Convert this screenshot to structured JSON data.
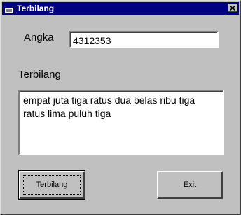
{
  "window": {
    "title": "Terbilang",
    "app_icon": "app-window-icon",
    "close_icon": "close-x-icon"
  },
  "form": {
    "angka_label": "Angka",
    "angka_value": "4312353",
    "terbilang_label": "Terbilang",
    "terbilang_text": "empat juta tiga ratus dua belas ribu tiga ratus lima puluh tiga"
  },
  "buttons": {
    "terbilang": {
      "mnemonic": "T",
      "rest": "erbilang"
    },
    "exit": {
      "prefix": "E",
      "mnemonic": "x",
      "rest": "it"
    }
  },
  "colors": {
    "titlebar": "#000080",
    "face": "#c0c0c0"
  }
}
